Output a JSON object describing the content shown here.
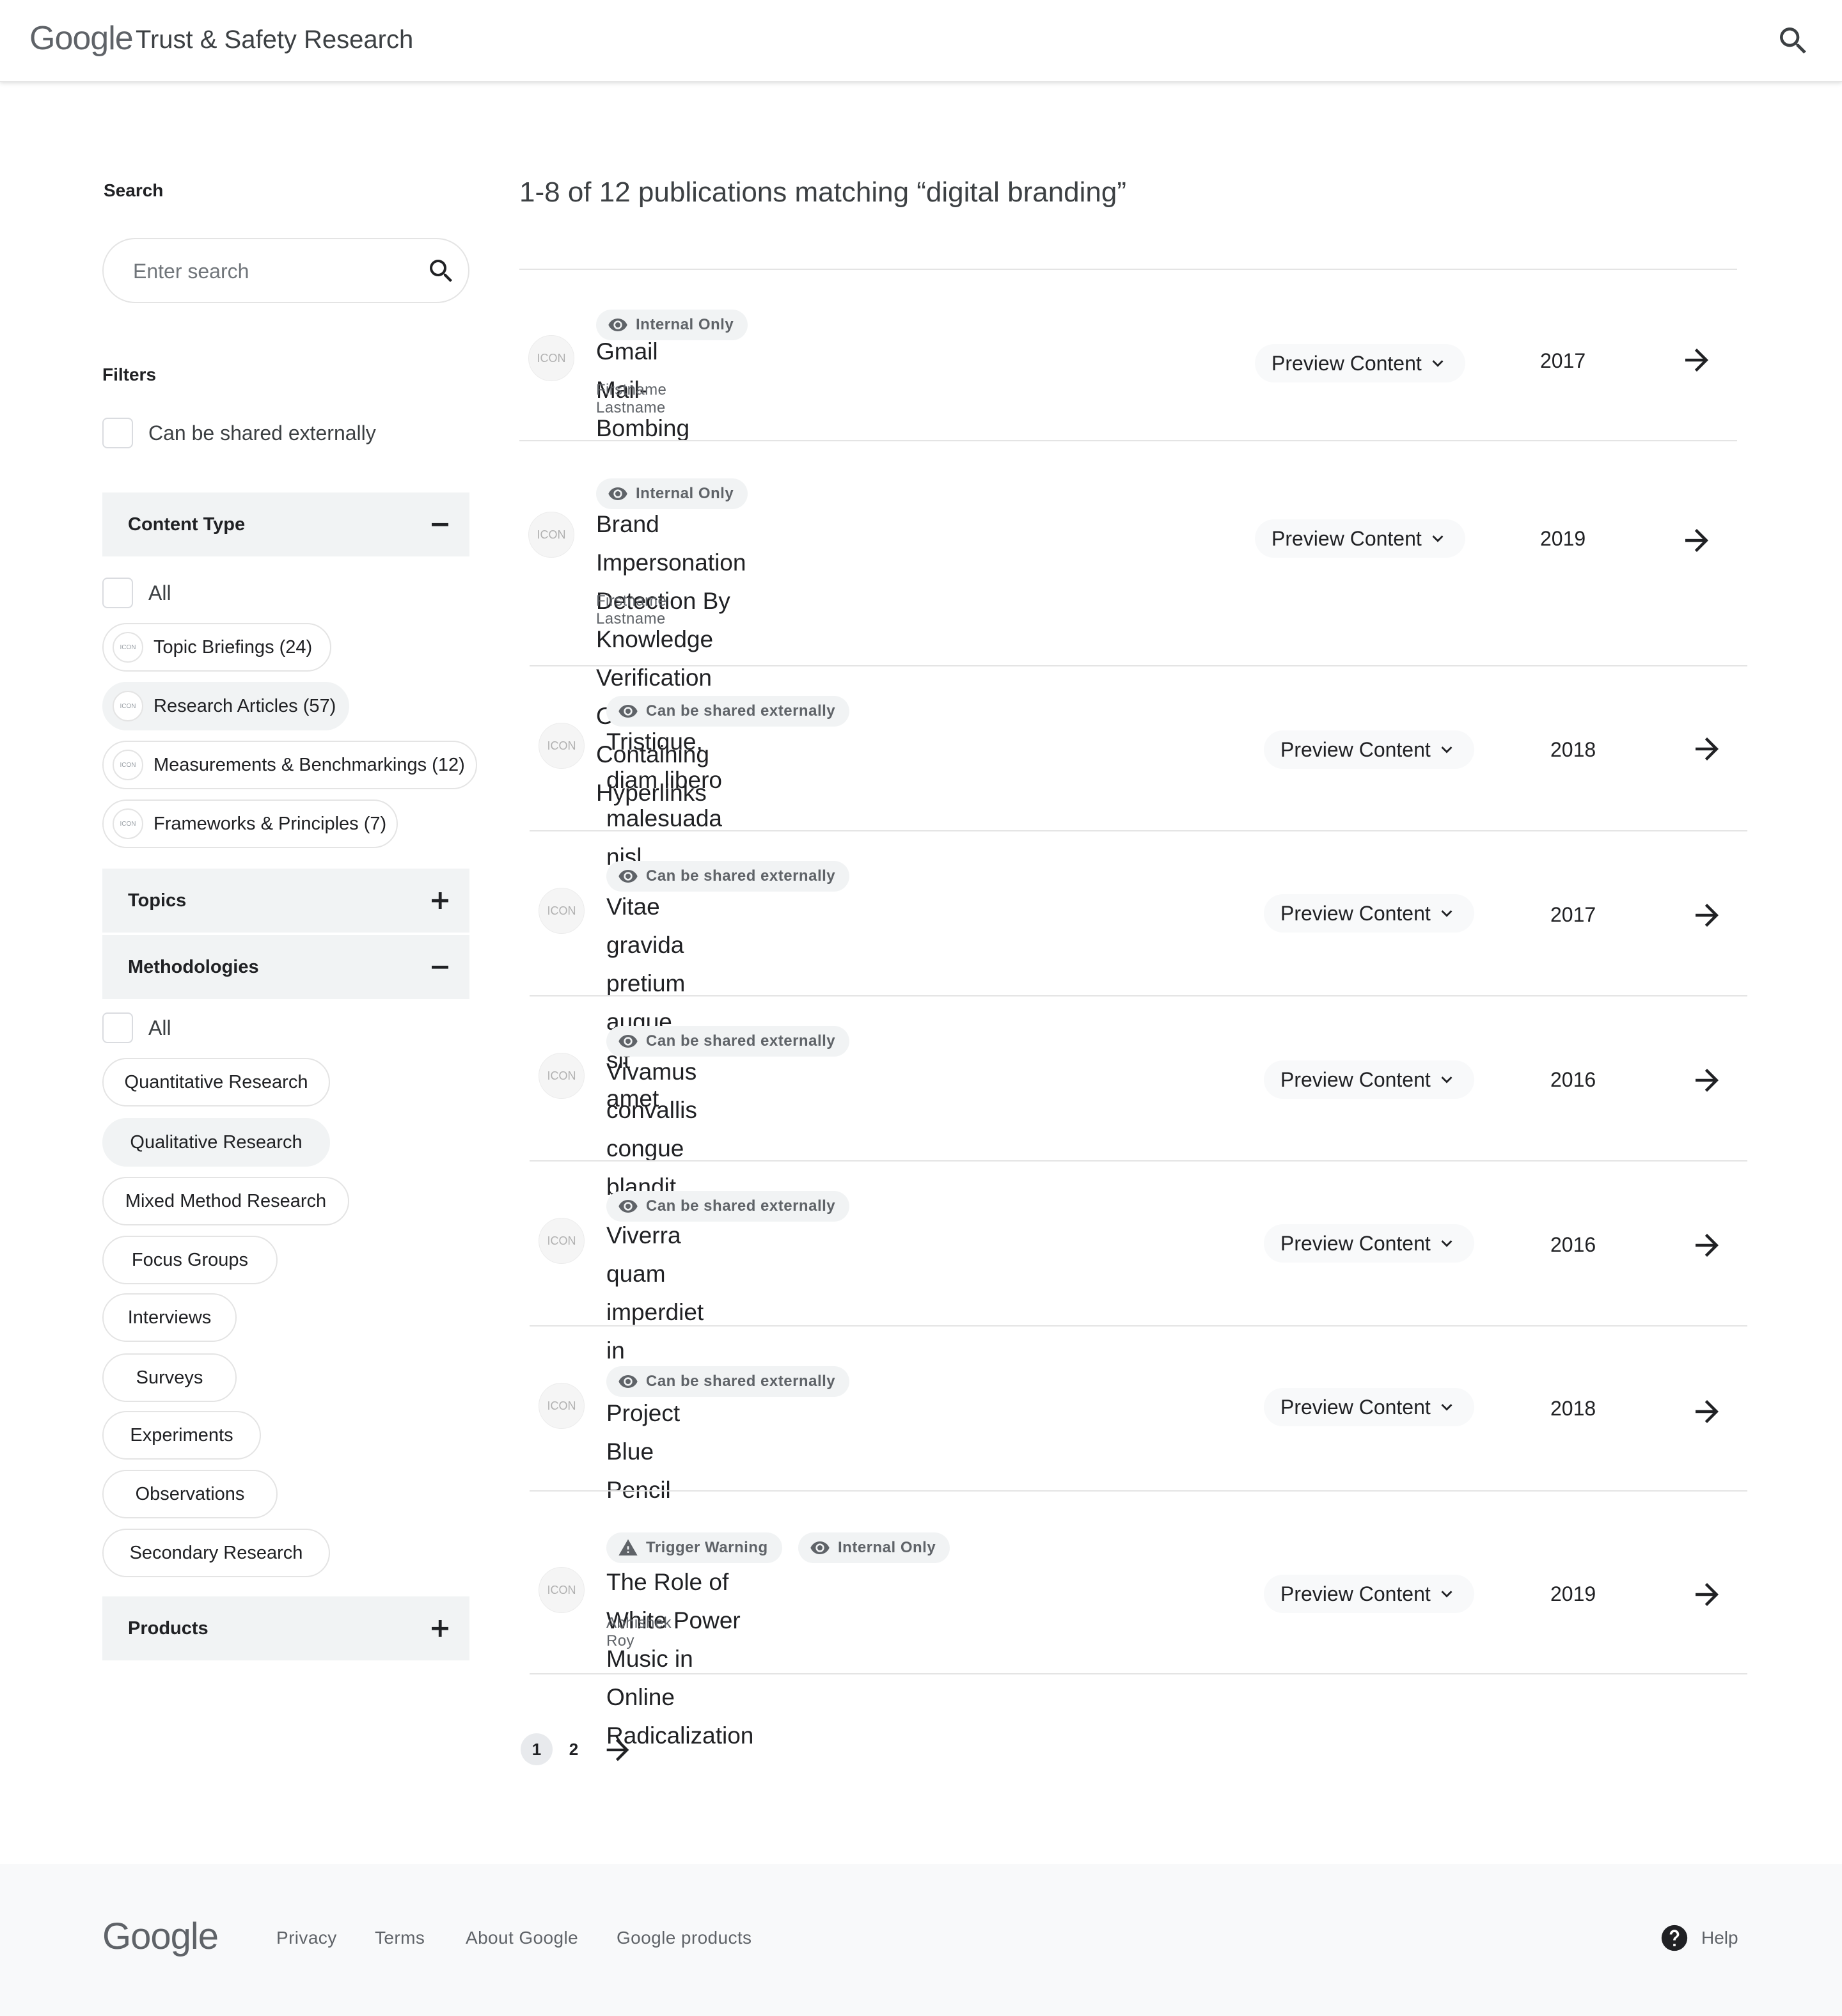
{
  "header": {
    "logo": "Google",
    "site_title": "Trust & Safety Research"
  },
  "sidebar": {
    "search_label": "Search",
    "search_placeholder": "Enter search",
    "filters_label": "Filters",
    "share_filter_label": "Can be shared externally",
    "content_type": {
      "title": "Content Type",
      "all_label": "All",
      "chips": [
        {
          "label": "Topic Briefings (24)",
          "icon_text": "ICON"
        },
        {
          "label": "Research Articles (57)",
          "icon_text": "ICON"
        },
        {
          "label": "Measurements & Benchmarkings (12)",
          "icon_text": "ICON"
        },
        {
          "label": "Frameworks & Principles (7)",
          "icon_text": "ICON"
        }
      ]
    },
    "topics": {
      "title": "Topics"
    },
    "methodologies": {
      "title": "Methodologies",
      "all_label": "All",
      "chips": [
        "Quantitative Research",
        "Qualitative Research",
        "Mixed Method Research",
        "Focus Groups",
        "Interviews",
        "Surveys",
        "Experiments",
        "Observations",
        "Secondary Research"
      ]
    },
    "products": {
      "title": "Products"
    }
  },
  "results": {
    "title": "1-8 of 12 publications matching “digital branding”",
    "preview_label": "Preview Content",
    "icon_text": "ICON",
    "items": [
      {
        "badges": [
          "Internal Only"
        ],
        "title_lines": [
          "Gmail Mail-Bombing"
        ],
        "author": "Firstname Lastname",
        "year": "2017"
      },
      {
        "badges": [
          "Internal Only"
        ],
        "title_lines": [
          "Brand Impersonation Detection By Knowledge",
          "Verification On Text Containing Hyperlinks"
        ],
        "author": "Firstname Lastname",
        "year": "2019"
      },
      {
        "badges": [
          "Can be shared externally"
        ],
        "title_lines": [
          "Tristique, diam libero malesuada nisl"
        ],
        "author": "",
        "year": "2018"
      },
      {
        "badges": [
          "Can be shared externally"
        ],
        "title_lines": [
          "Vitae gravida pretium augue, sit amet"
        ],
        "author": "",
        "year": "2017"
      },
      {
        "badges": [
          "Can be shared externally"
        ],
        "title_lines": [
          "Vivamus convallis congue blandit"
        ],
        "author": "",
        "year": "2016"
      },
      {
        "badges": [
          "Can be shared externally"
        ],
        "title_lines": [
          "Viverra quam imperdiet in"
        ],
        "author": "",
        "year": "2016"
      },
      {
        "badges": [
          "Can be shared externally"
        ],
        "title_lines": [
          "Project Blue Pencil"
        ],
        "author": "",
        "year": "2018"
      },
      {
        "badges": [
          "Trigger Warning",
          "Internal Only"
        ],
        "title_lines": [
          "The Role of White Power Music in Online Radicalization"
        ],
        "author": "Abhishek Roy",
        "year": "2019"
      }
    ]
  },
  "pagination": {
    "pages": [
      "1",
      "2"
    ],
    "current": "1"
  },
  "footer": {
    "logo": "Google",
    "links": [
      "Privacy",
      "Terms",
      "About Google",
      "Google products"
    ],
    "help_label": "Help"
  },
  "colors": {
    "text": "#202124",
    "muted": "#5f6368",
    "panel": "#f1f3f4",
    "border": "#e4e4e4",
    "footer_bg": "#f8f9fa"
  }
}
